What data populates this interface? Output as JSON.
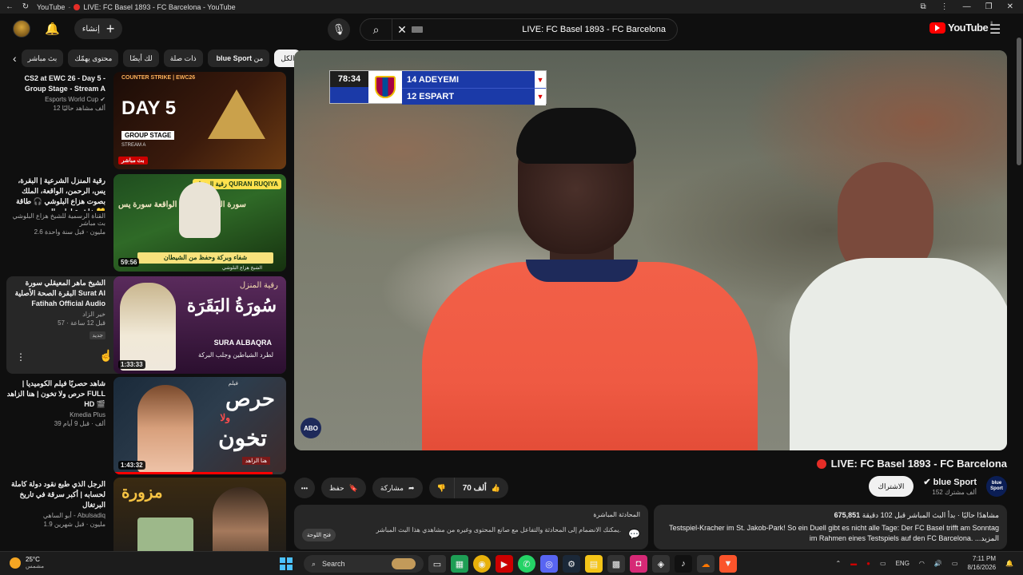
{
  "titlebar": {
    "brand": "YouTube",
    "tab_title": "LIVE: FC Basel 1893 - FC Barcelona - YouTube"
  },
  "header": {
    "create_label": "إنشاء",
    "search_value": "LIVE: FC Basel 1893 - FC Barcelona",
    "logo_text": "YouTube",
    "logo_country": "IL"
  },
  "chips": [
    {
      "label": "الكل"
    },
    {
      "label": "من",
      "bold": "blue Sport"
    },
    {
      "label": "ذات صلة"
    },
    {
      "label": "لك أيضًا"
    },
    {
      "label": "محتوى يهمّك"
    },
    {
      "label": "بث مباشر"
    }
  ],
  "recs": [
    {
      "title": "CS2 at EWC 26 - Day 5 - Group Stage - Stream A",
      "channel": "Esports World Cup",
      "stats": "12 ألف مشاهد حاليًا",
      "badge": "بث مباشر",
      "thumb": {
        "day": "DAY 5",
        "gs": "GROUP STAGE",
        "sa": "STREAM A",
        "brand": "COUNTER STRIKE | EWC26"
      }
    },
    {
      "title": "رقية المنزل الشرعية | البقرة، يس، الرحمن، الواقعة، الملك بصوت هزاع البلوشي 🎧 طاقة خاشعة لطرد الهم 💛",
      "channel": "القناة الرسمية للشيخ هزاع البلوشي بث مباشر",
      "stats": "2.6 مليون · قبل سنة واحدة",
      "duration": "59:56",
      "thumb": {
        "tag": "رقية المنزل QURAN RUQIYA",
        "ar": "سورة الرحمن سورة الواقعة سورة يس",
        "band": "شفاء وبركة وحفظ من الشيطان",
        "sheikh": "الشيخ هزاع البلوشي"
      }
    },
    {
      "title": "الشيخ ماهر المعيقلي سورة البقرة الصحة الأصلية Surat Al Fatihah Official Audio",
      "channel": "خير الزاد",
      "stats": "57 · قبل 12 ساعة",
      "new": "جديد",
      "duration": "1:33:33",
      "thumb": {
        "ar": "رقية المنزل",
        "big": "سُورَةُ البَقَرَة",
        "en": "SURA ALBAQRA",
        "ar2": "لطرد الشياطين وجلب البركة"
      }
    },
    {
      "title": "شاهد حصريًا فيلم الكوميديا | حرص ولا تخون | هنا الزاهد FULL HD 🎬",
      "channel": "Kmedia Plus",
      "stats": "39 ألف · قبل 9 أيام",
      "duration": "1:43:32",
      "progress": 0.92,
      "thumb": {
        "w1": "حرص",
        "w2": "تخون",
        "small": "ولا",
        "film": "فيلم",
        "star": "هنا الزاهد"
      }
    },
    {
      "title": "الرجل الذي طبع نقود دولة كاملة لحسابه | أكبر سرقة في تاريخ البرتغال",
      "channel": "أبو الساهي - Abulsadiq",
      "stats": "1.9 مليون · قبل شهرين",
      "thumb": {
        "w": "مزورة"
      }
    }
  ],
  "player": {
    "scoreboard": {
      "time": "78:34",
      "home": "14 ADEYEMI",
      "away": "12 ESPART"
    },
    "abo": "ABO"
  },
  "video": {
    "title": "LIVE: FC Basel 1893 - FC Barcelona"
  },
  "actions": {
    "more": "•••",
    "save": "حفظ",
    "share": "مشاركة",
    "likes": "70 ألف"
  },
  "channel": {
    "name": "blue Sport",
    "subs": "152 ألف مشترك",
    "subscribe": "الاشتراك",
    "logo": "blue Sport"
  },
  "chat": {
    "heading": "المحادثة المباشرة",
    "message": "يمكنك الانضمام إلى المحادثة والتفاعل مع صانع المحتوى وغيره من مشاهدي هذا البث المباشر.",
    "open": "فتح اللوحة"
  },
  "description": {
    "stats_views": "675,851",
    "stats_text": "مشاهدًا حاليًا · بدأ البث المباشر قبل 102 دقيقة",
    "line1": "Testspiel-Kracher im St. Jakob-Park! So ein Duell gibt es nicht alle Tage: Der FC Basel trifft am Sonntag",
    "line2": "im Rahmen eines Testspiels auf den FC Barcelona. ...المزيد"
  },
  "taskbar": {
    "weather_temp": "25°C",
    "weather_cond": "مشمس",
    "search": "Search",
    "lang": "ENG",
    "time": "7:11 PM",
    "date": "8/16/2026"
  },
  "colors": {
    "accent_red": "#ff0000",
    "background": "#0f0f0f",
    "chip_bg": "#272727",
    "score_blue": "#1b3aa8",
    "shirt": "#ef5a43"
  }
}
